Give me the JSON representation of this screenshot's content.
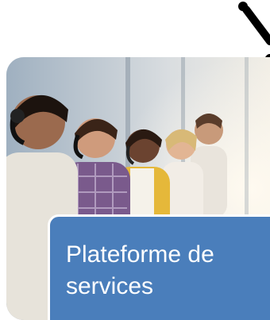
{
  "caption": {
    "text": "Plateforme de\nservices"
  },
  "photo": {
    "subject": "call-center-agents-with-headsets-photo"
  },
  "icons": {
    "tools": "wrench-screwdriver-icon"
  },
  "colors": {
    "caption_background": "#4a7ebb",
    "caption_text": "#ffffff",
    "icon": "#000000"
  }
}
